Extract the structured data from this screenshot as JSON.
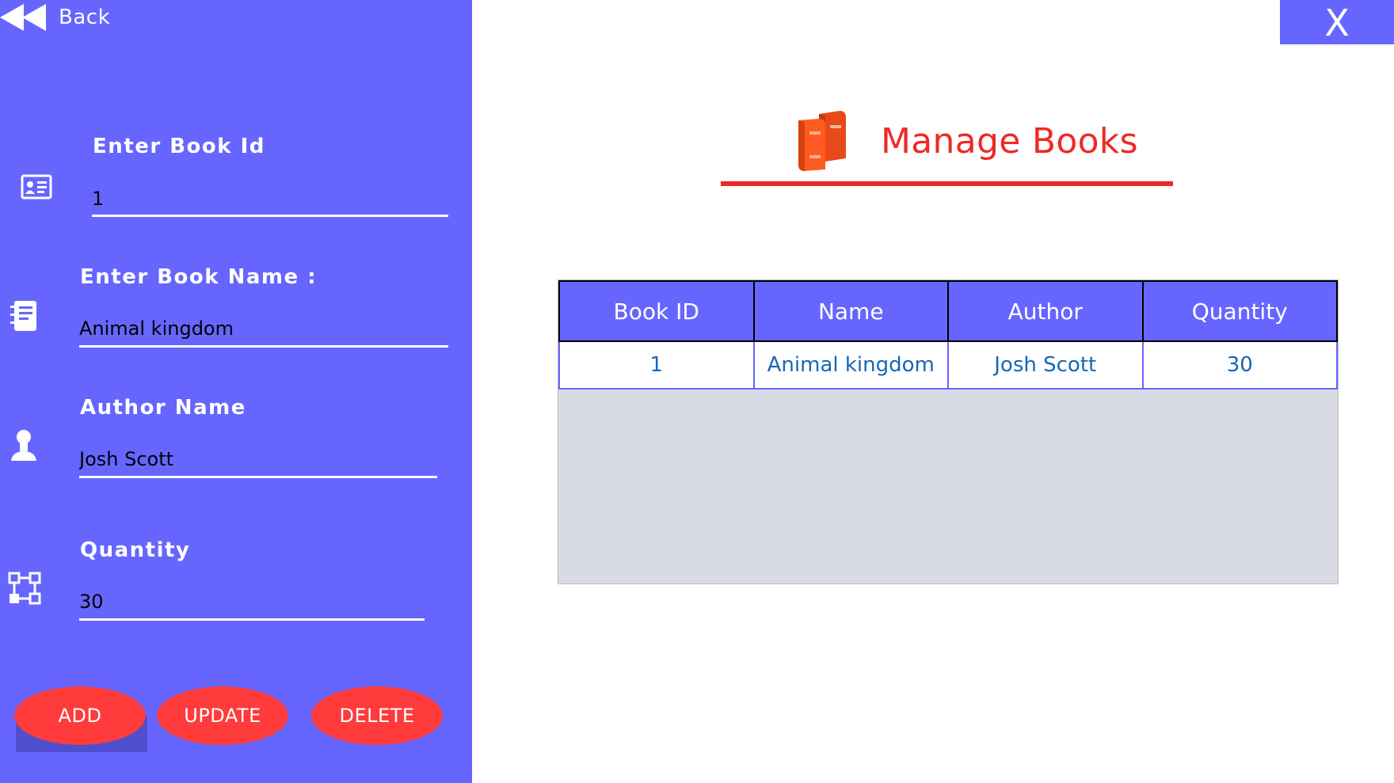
{
  "nav": {
    "back_label": "Back",
    "close_label": "X"
  },
  "form": {
    "book_id": {
      "label": "Enter Book Id",
      "value": "1"
    },
    "book_name": {
      "label": "Enter Book Name :",
      "value": "Animal kingdom"
    },
    "author": {
      "label": "Author Name",
      "value": "Josh Scott"
    },
    "quantity": {
      "label": "Quantity",
      "value": "30"
    }
  },
  "buttons": {
    "add": "ADD",
    "update": "UPDATE",
    "delete": "DELETE"
  },
  "header": {
    "title": "Manage Books",
    "icon": "books-icon"
  },
  "table": {
    "columns": [
      "Book ID",
      "Name",
      "Author",
      "Quantity"
    ],
    "rows": [
      [
        "1",
        "Animal kingdom",
        "Josh Scott",
        "30"
      ]
    ]
  },
  "colors": {
    "panel": "#6666ff",
    "button": "#ff3b3b",
    "title": "#ee2a24",
    "cell_text": "#1667b6",
    "table_empty": "#d8dbe2"
  }
}
